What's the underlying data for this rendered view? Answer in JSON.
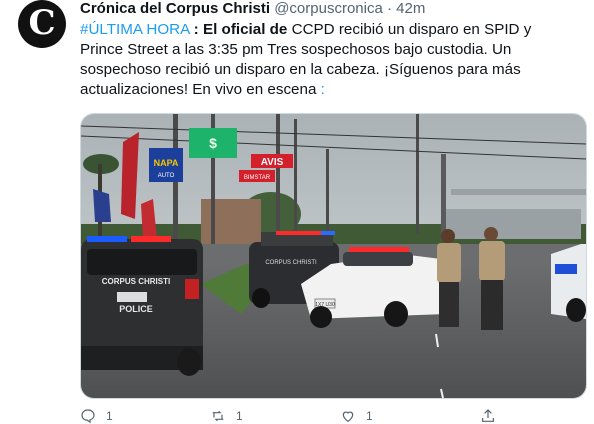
{
  "tweet": {
    "avatar_letter": "C",
    "author_name": "Crónica del Corpus Christi",
    "handle": "@corpuscronica",
    "separator": "·",
    "time": "42m",
    "hashtag": "#ÚLTIMA HORA",
    "colon": ":",
    "bold_text": "El oficial de",
    "body_text": "CCPD recibió un disparo en SPID y Prince Street a las 3:35 pm Tres sospechosos bajo custodia. Un sospechoso recibió un disparo en la cabeza. ¡Síguenos para más actualizaciones! En vivo en escena",
    "trailing": ":",
    "image_signs": {
      "nada": "NAPA",
      "nada_sub": "AUTO",
      "avis": "AVIS",
      "rent": "BIMSTAR",
      "green": "$"
    },
    "car_text": {
      "left_top": "CORPUS CHRISTI",
      "left_bottom": "POLICE",
      "mid": "CORPUS CHRISTI",
      "plate": "1X7 U30"
    }
  },
  "actions": {
    "reply_count": "1",
    "retweet_count": "1",
    "like_count": "1"
  },
  "colors": {
    "accent": "#1d9bf0",
    "text": "#0f1419",
    "muted": "#536471"
  }
}
